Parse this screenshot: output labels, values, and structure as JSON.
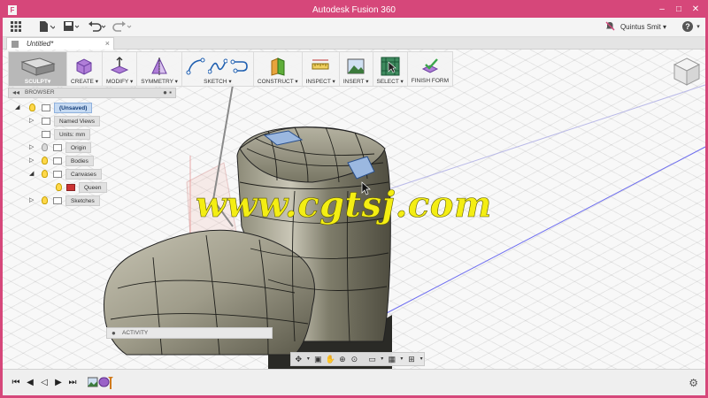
{
  "window": {
    "title": "Autodesk Fusion 360"
  },
  "topbar": {
    "user_name": "Quintus Smit",
    "help_symbol": "?"
  },
  "document_tab": {
    "name": "Untitled*",
    "close_symbol": "×"
  },
  "toolbar": {
    "workspace_label": "SCULPT",
    "groups": {
      "create": "CREATE",
      "modify": "MODIFY",
      "symmetry": "SYMMETRY",
      "sketch": "SKETCH",
      "construct": "CONSTRUCT",
      "inspect": "INSPECT",
      "insert": "INSERT",
      "select": "SELECT",
      "finish_form": "FINISH FORM"
    }
  },
  "browser": {
    "title": "BROWSER",
    "root": "(Unsaved)",
    "items": {
      "named_views": "Named Views",
      "units": "Units: mm",
      "origin": "Origin",
      "bodies": "Bodies",
      "canvases": "Canvases",
      "queen": "Queen",
      "sketches": "Sketches"
    }
  },
  "activity": {
    "label": "ACTIVITY"
  },
  "watermark": {
    "text": "www.cgtsj.com"
  },
  "icons": {
    "app": "fusion-app-icon",
    "grid": "apps-grid-icon",
    "file": "file-icon",
    "save": "save-icon",
    "undo": "undo-icon",
    "redo": "redo-icon",
    "settings": "gear-icon"
  }
}
